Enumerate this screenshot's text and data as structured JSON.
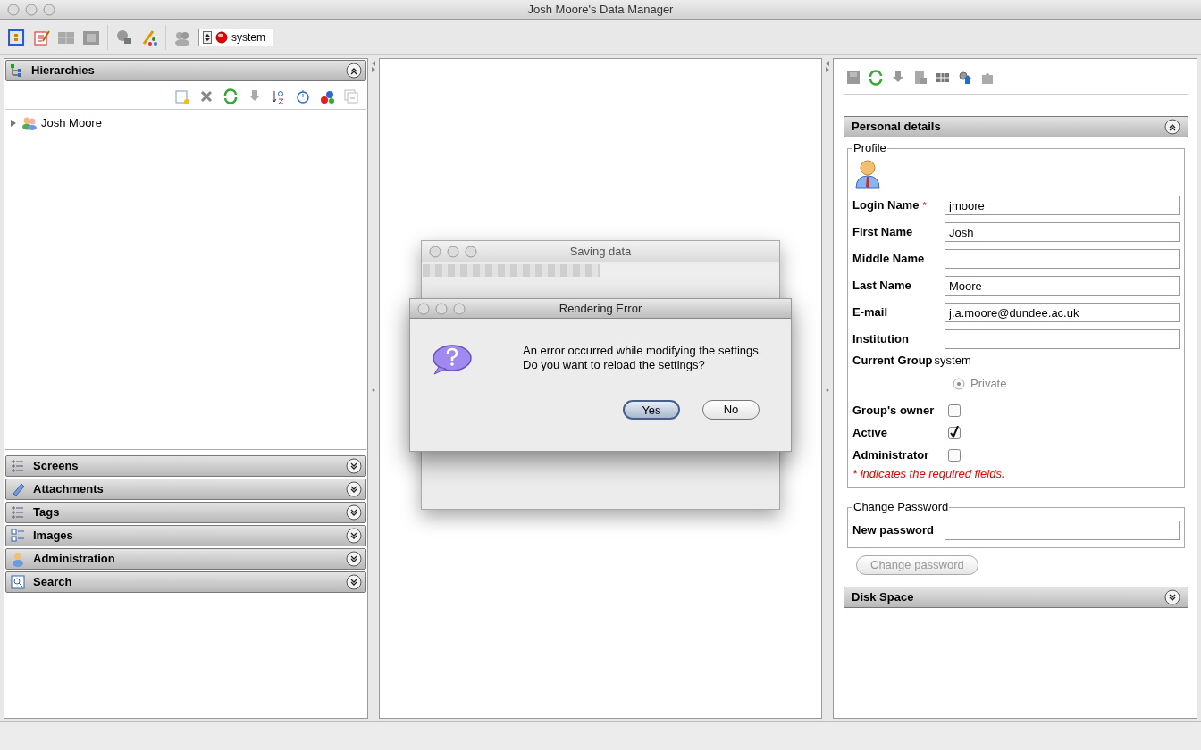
{
  "window": {
    "title": "Josh Moore's Data Manager"
  },
  "toolbar": {
    "group_selector": "system"
  },
  "hierarchies": {
    "title": "Hierarchies",
    "expanded": true,
    "tree": [
      {
        "label": "Josh Moore",
        "expanded": false
      }
    ]
  },
  "sections": [
    {
      "title": "Screens",
      "expanded": false
    },
    {
      "title": "Attachments",
      "expanded": false
    },
    {
      "title": "Tags",
      "expanded": false
    },
    {
      "title": "Images",
      "expanded": false
    },
    {
      "title": "Administration",
      "expanded": false
    },
    {
      "title": "Search",
      "expanded": false
    }
  ],
  "details": {
    "title": "Personal details",
    "expanded": true,
    "profile_legend": "Profile",
    "fields": [
      {
        "label": "Login Name",
        "value": "jmoore",
        "required": true
      },
      {
        "label": "First Name",
        "value": "Josh",
        "required": false
      },
      {
        "label": "Middle Name",
        "required": false
      },
      {
        "label": "Last Name",
        "value": "Moore",
        "required": false
      },
      {
        "label": "E-mail",
        "value": "j.a.moore@dundee.ac.uk",
        "required": false
      },
      {
        "label": "Institution",
        "required": false
      }
    ],
    "required_marker": "*",
    "current_group": {
      "label": "Current Group",
      "value": "system"
    },
    "permission": {
      "label": "Private",
      "selected": true,
      "disabled": true
    },
    "checkboxes": [
      {
        "label": "Group's owner",
        "checked": false
      },
      {
        "label": "Active",
        "checked": true
      },
      {
        "label": "Administrator",
        "checked": false
      }
    ],
    "required_note": "* indicates the required fields.",
    "password": {
      "legend": "Change Password",
      "label": "New password",
      "button": "Change password",
      "button_disabled": true
    },
    "disk_space": {
      "title": "Disk Space",
      "expanded": false
    }
  },
  "saving_dialog": {
    "title": "Saving data",
    "level": 0.5
  },
  "error_dialog": {
    "title": "Rendering Error",
    "message": [
      "An error occurred while modifying the settings.",
      "Do you want to reload the settings?"
    ],
    "buttons": [
      {
        "label": "Yes",
        "default": true
      },
      {
        "label": "No",
        "default": false
      }
    ]
  }
}
